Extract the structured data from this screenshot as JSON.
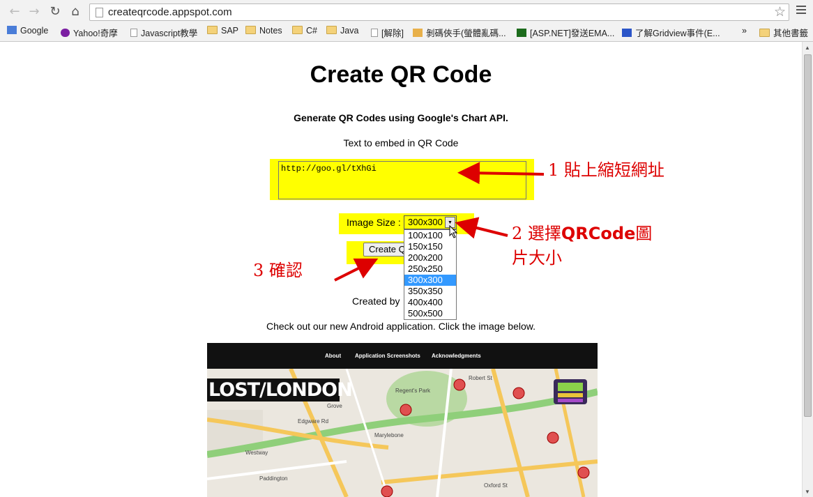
{
  "browser": {
    "url": "createqrcode.appspot.com",
    "bookmarks": [
      {
        "label": "Google",
        "icon": "google-icon"
      },
      {
        "label": "Yahoo!奇摩",
        "icon": "yahoo-icon"
      },
      {
        "label": "Javascript教學",
        "icon": "page-icon"
      },
      {
        "label": "SAP",
        "icon": "folder-icon"
      },
      {
        "label": "Notes",
        "icon": "folder-icon"
      },
      {
        "label": "C#",
        "icon": "folder-icon"
      },
      {
        "label": "Java",
        "icon": "folder-icon"
      },
      {
        "label": "[解除]",
        "icon": "page-icon"
      },
      {
        "label": "剝碼俠手(螢體亂碼...",
        "icon": "site-icon"
      },
      {
        "label": "[ASP.NET]發送EMA...",
        "icon": "site-icon"
      },
      {
        "label": "了解Gridview事件(E...",
        "icon": "site-icon"
      },
      {
        "label": "其他書籤",
        "icon": "folder-icon"
      }
    ],
    "overflow": "»"
  },
  "page": {
    "title": "Create QR Code",
    "subtitle": "Generate QR Codes using Google's Chart API.",
    "embed_label": "Text to embed in QR Code",
    "embed_value": "http://goo.gl/tXhGi",
    "size_label": "Image Size :",
    "size_selected": "300x300",
    "size_options": [
      "100x100",
      "150x150",
      "200x200",
      "250x250",
      "300x300",
      "350x350",
      "400x400",
      "500x500"
    ],
    "create_button": "Create QR Code",
    "created_by": "Created by",
    "checkout": "Check out our new Android application. Click the image below."
  },
  "banner": {
    "nav": [
      "About",
      "Application Screenshots",
      "Acknowledgments"
    ],
    "logo": "LOST/LONDON",
    "map_labels": [
      "Regent's Park",
      "Marylebone",
      "Paddington",
      "Westway",
      "Grove",
      "Robert St",
      "Oxford St",
      "Edgware Rd"
    ]
  },
  "annotations": {
    "step1": "1 貼上縮短網址",
    "step2_prefix": "2 選擇",
    "step2_bold": "QRCode",
    "step2_suffix": "圖",
    "step2_line2": "片大小",
    "step3": "3 確認"
  },
  "colors": {
    "highlight": "#ffff00",
    "annotation": "#dd0000",
    "selected": "#3399ff"
  }
}
